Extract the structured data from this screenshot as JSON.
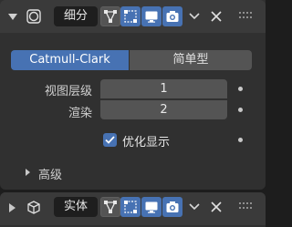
{
  "modifier1": {
    "name": "细分",
    "modes": [
      "Catmull-Clark",
      "简单型"
    ],
    "active_mode": "Catmull-Clark",
    "fields": [
      {
        "label": "视图层级",
        "value": "1"
      },
      {
        "label": "渲染",
        "value": "2"
      }
    ],
    "checkbox": {
      "label": "优化显示",
      "checked": true
    },
    "advanced_label": "高级"
  },
  "modifier2": {
    "name": "实体"
  },
  "colors": {
    "accent": "#4772b3",
    "panel": "#303030",
    "header": "#3a3a3a",
    "field": "#545454"
  }
}
